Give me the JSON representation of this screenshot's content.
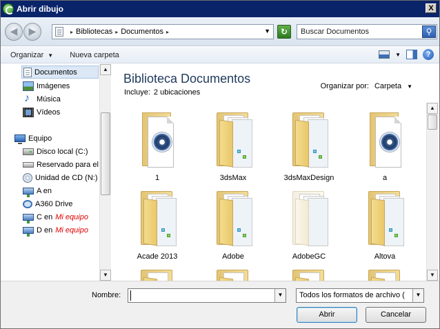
{
  "window": {
    "title": "Abrir dibujo",
    "close_label": "X"
  },
  "address": {
    "crumbs": [
      "Bibliotecas",
      "Documentos"
    ],
    "search_placeholder": "Buscar Documentos"
  },
  "toolbar": {
    "organize_label": "Organizar",
    "new_folder_label": "Nueva carpeta"
  },
  "sidebar": {
    "items": [
      {
        "label": "Documentos",
        "icon": "document-icon",
        "selected": true
      },
      {
        "label": "Imágenes",
        "icon": "pictures-icon"
      },
      {
        "label": "Música",
        "icon": "music-icon"
      },
      {
        "label": "Vídeos",
        "icon": "video-icon"
      },
      {
        "label": "Equipo",
        "icon": "computer-icon"
      },
      {
        "label": "Disco local (C:)",
        "icon": "local-disk-icon"
      },
      {
        "label": "Reservado para el",
        "icon": "hard-drive-icon"
      },
      {
        "label": "Unidad de CD (N:)",
        "icon": "cd-drive-icon"
      },
      {
        "label": "A en",
        "icon": "network-drive-icon"
      },
      {
        "label": "A360 Drive",
        "icon": "cloud-drive-icon"
      },
      {
        "label": "C en",
        "suffix": "Mi equipo",
        "icon": "network-drive-icon"
      },
      {
        "label": "D en",
        "suffix": "Mi equipo",
        "icon": "network-drive-icon"
      }
    ]
  },
  "library": {
    "title": "Biblioteca Documentos",
    "includes_label": "Incluye:",
    "includes_link": "2 ubicaciones",
    "arrange_label": "Organizar por:",
    "arrange_value": "Carpeta"
  },
  "items": [
    {
      "name": "1",
      "type": "file"
    },
    {
      "name": "3dsMax",
      "type": "folder"
    },
    {
      "name": "3dsMaxDesign",
      "type": "folder"
    },
    {
      "name": "a",
      "type": "file"
    },
    {
      "name": "Acade 2013",
      "type": "folder"
    },
    {
      "name": "Adobe",
      "type": "folder"
    },
    {
      "name": "AdobeGC",
      "type": "folder-hidden"
    },
    {
      "name": "Altova",
      "type": "folder"
    }
  ],
  "footer": {
    "name_label": "Nombre:",
    "name_value": "",
    "filter_value": "Todos los formatos de archivo (",
    "open_label": "Abrir",
    "cancel_label": "Cancelar"
  }
}
